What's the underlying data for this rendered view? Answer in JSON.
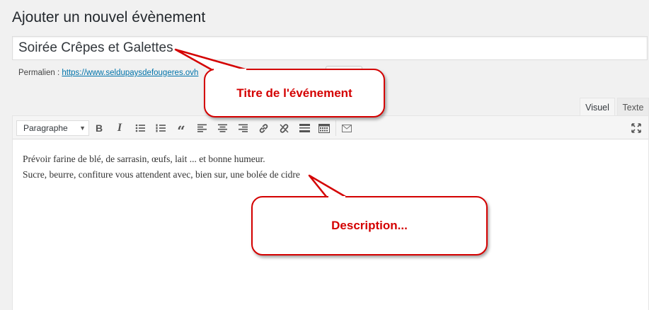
{
  "page": {
    "title": "Ajouter un nouvel évènement",
    "event_title_value": "Soirée Crêpes et Galettes"
  },
  "permalink": {
    "label": "Permalien :",
    "url": "https://www.seldupaysdefougeres.ovh"
  },
  "editor": {
    "tabs": [
      {
        "label": "Visuel",
        "active": true
      },
      {
        "label": "Texte",
        "active": false
      }
    ],
    "format_selected": "Paragraphe",
    "toolbar_icons": [
      "bold-icon",
      "italic-icon",
      "bullet-list-icon",
      "numbered-list-icon",
      "blockquote-icon",
      "align-left-icon",
      "align-center-icon",
      "align-right-icon",
      "link-icon",
      "unlink-icon",
      "read-more-icon",
      "toolbar-toggle-icon",
      "mail-icon",
      "fullscreen-icon"
    ],
    "content_lines": [
      "Prévoir farine de blé, de sarrasin, œufs, lait ... et bonne humeur.",
      "Sucre, beurre, confiture vous attendent avec, bien sur, une bolée de cidre"
    ]
  },
  "annotations": {
    "title_callout": "Titre de l'événement",
    "description_callout": "Description..."
  },
  "colors": {
    "callout_red": "#d40000",
    "link_blue": "#0073aa",
    "background": "#f1f1f1"
  }
}
